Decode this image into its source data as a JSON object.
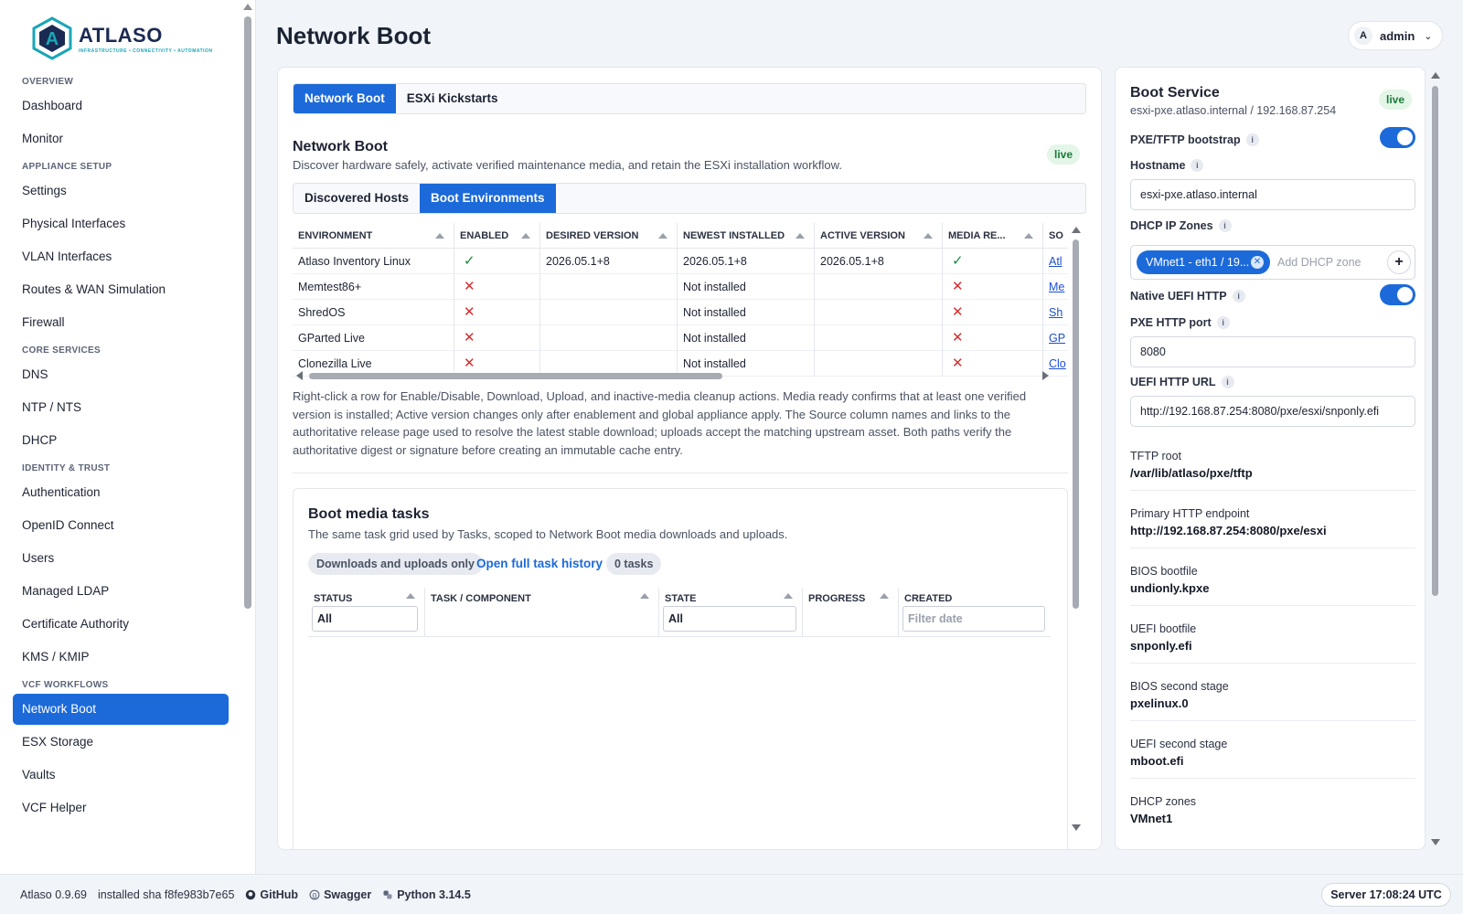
{
  "app": {
    "logo_name": "ATLASO",
    "logo_tagline": "INFRASTRUCTURE • CONNECTIVITY • AUTOMATION",
    "page_title": "Network Boot",
    "user_initial": "A",
    "user_name": "admin"
  },
  "sidebar": {
    "sections": [
      {
        "title": "OVERVIEW",
        "items": [
          "Dashboard",
          "Monitor"
        ]
      },
      {
        "title": "APPLIANCE SETUP",
        "items": [
          "Settings",
          "Physical Interfaces",
          "VLAN Interfaces",
          "Routes & WAN Simulation",
          "Firewall"
        ]
      },
      {
        "title": "CORE SERVICES",
        "items": [
          "DNS",
          "NTP / NTS",
          "DHCP"
        ]
      },
      {
        "title": "IDENTITY & TRUST",
        "items": [
          "Authentication",
          "OpenID Connect",
          "Users",
          "Managed LDAP",
          "Certificate Authority",
          "KMS / KMIP"
        ]
      },
      {
        "title": "VCF WORKFLOWS",
        "items": [
          "Network Boot",
          "ESX Storage",
          "Vaults",
          "VCF Helper"
        ]
      }
    ],
    "active_item": "Network Boot"
  },
  "main": {
    "top_tabs": [
      "Network Boot",
      "ESXi Kickstarts"
    ],
    "section_title": "Network Boot",
    "section_desc": "Discover hardware safely, activate verified maintenance media, and retain the ESXi installation workflow.",
    "live_label": "live",
    "sub_tabs": [
      "Discovered Hosts",
      "Boot Environments"
    ],
    "env_table": {
      "columns": [
        "ENVIRONMENT",
        "ENABLED",
        "DESIRED VERSION",
        "NEWEST INSTALLED",
        "ACTIVE VERSION",
        "MEDIA RE...",
        "SO"
      ],
      "rows": [
        {
          "environment": "Atlaso Inventory Linux",
          "enabled": "✓",
          "desired": "2026.05.1+8",
          "newest": "2026.05.1+8",
          "active": "2026.05.1+8",
          "media": "✓",
          "source": "Atl"
        },
        {
          "environment": "Memtest86+",
          "enabled": "✕",
          "desired": "",
          "newest": "Not installed",
          "active": "",
          "media": "✕",
          "source": "Me"
        },
        {
          "environment": "ShredOS",
          "enabled": "✕",
          "desired": "",
          "newest": "Not installed",
          "active": "",
          "media": "✕",
          "source": "Sh"
        },
        {
          "environment": "GParted Live",
          "enabled": "✕",
          "desired": "",
          "newest": "Not installed",
          "active": "",
          "media": "✕",
          "source": "GP"
        },
        {
          "environment": "Clonezilla Live",
          "enabled": "✕",
          "desired": "",
          "newest": "Not installed",
          "active": "",
          "media": "✕",
          "source": "Clo"
        }
      ]
    },
    "help_text": "Right-click a row for Enable/Disable, Download, Upload, and inactive-media cleanup actions. Media ready confirms that at least one verified version is installed; Active version changes only after enablement and global appliance apply. The Source column names and links to the authoritative release page used to resolve the latest stable download; uploads accept the matching upstream asset. Both paths verify the authoritative digest or signature before creating an immutable cache entry.",
    "tasks": {
      "title": "Boot media tasks",
      "desc": "The same task grid used by Tasks, scoped to Network Boot media downloads and uploads.",
      "filter_pill": "Downloads and uploads only",
      "history_link": "Open full task history",
      "count_pill": "0 tasks",
      "columns": [
        "STATUS",
        "TASK / COMPONENT",
        "STATE",
        "PROGRESS",
        "CREATED"
      ],
      "status_filter": "All",
      "state_filter": "All",
      "created_placeholder": "Filter date"
    }
  },
  "boot_service": {
    "title": "Boot Service",
    "subtitle": "esxi-pxe.atlaso.internal / 192.168.87.254",
    "live_label": "live",
    "pxe_label": "PXE/TFTP bootstrap",
    "pxe_enabled": true,
    "hostname_label": "Hostname",
    "hostname_value": "esxi-pxe.atlaso.internal",
    "dhcp_label": "DHCP IP Zones",
    "dhcp_chip": "VMnet1 - eth1 / 19...",
    "dhcp_placeholder": "Add DHCP zone",
    "uefi_http_label": "Native UEFI HTTP",
    "uefi_http_enabled": true,
    "http_port_label": "PXE HTTP port",
    "http_port_value": "8080",
    "uefi_url_label": "UEFI HTTP URL",
    "uefi_url_value": "http://192.168.87.254:8080/pxe/esxi/snponly.efi",
    "details": [
      {
        "key": "TFTP root",
        "value": "/var/lib/atlaso/pxe/tftp"
      },
      {
        "key": "Primary HTTP endpoint",
        "value": "http://192.168.87.254:8080/pxe/esxi"
      },
      {
        "key": "BIOS bootfile",
        "value": "undionly.kpxe"
      },
      {
        "key": "UEFI bootfile",
        "value": "snponly.efi"
      },
      {
        "key": "BIOS second stage",
        "value": "pxelinux.0"
      },
      {
        "key": "UEFI second stage",
        "value": "mboot.efi"
      },
      {
        "key": "DHCP zones",
        "value": "VMnet1"
      }
    ]
  },
  "footer": {
    "version": "Atlaso 0.9.69",
    "installed": "installed sha f8fe983b7e65",
    "github": "GitHub",
    "swagger": "Swagger",
    "python": "Python 3.14.5",
    "server_time": "Server 17:08:24 UTC"
  }
}
